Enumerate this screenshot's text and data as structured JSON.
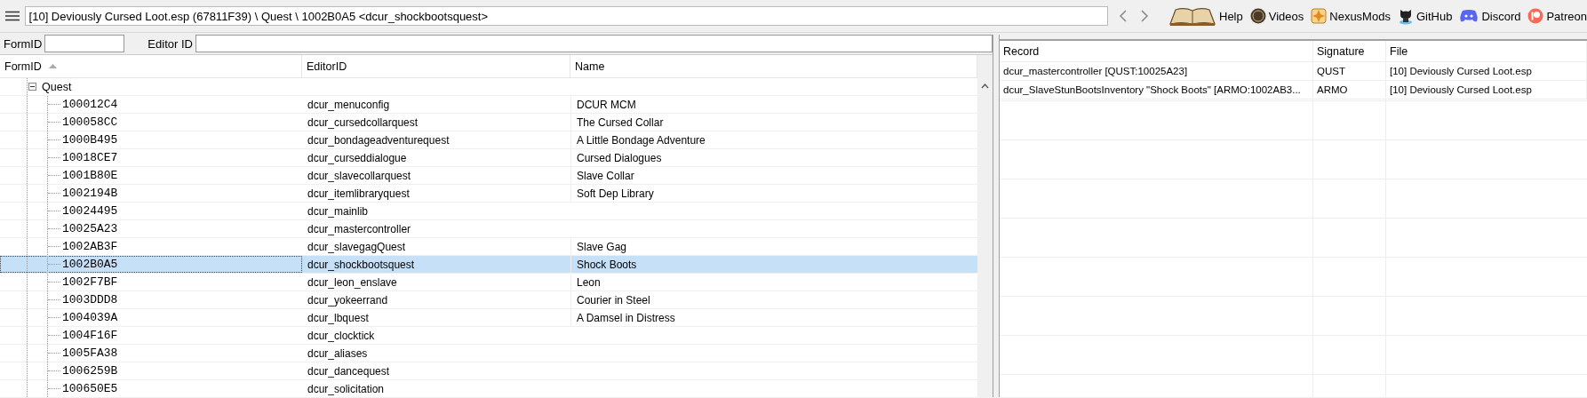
{
  "address": "[10] Deviously Cursed Loot.esp (67811F39) \\ Quest \\ 1002B0A5 <dcur_shockbootsquest>",
  "links": [
    {
      "kind": "book",
      "label": "Help"
    },
    {
      "kind": "coin",
      "label": "Videos"
    },
    {
      "kind": "star",
      "label": "NexusMods"
    },
    {
      "kind": "cat",
      "label": "GitHub"
    },
    {
      "kind": "controller",
      "label": "Discord"
    },
    {
      "kind": "ring",
      "label": "Patreon"
    }
  ],
  "filters": [
    {
      "label": "FormID"
    },
    {
      "label": "Editor ID"
    }
  ],
  "tree": {
    "columns": [
      {
        "label": "FormID",
        "sorted": true
      },
      {
        "label": "EditorID",
        "sorted": false
      },
      {
        "label": "Name",
        "sorted": false
      }
    ],
    "nodes": [
      {
        "label": "Quest",
        "expanded": true,
        "children": [
          {
            "form_id": "100012C4",
            "editor_id": "dcur_menuconfig",
            "name": "DCUR MCM",
            "selected": false
          },
          {
            "form_id": "100058CC",
            "editor_id": "dcur_cursedcollarquest",
            "name": "The Cursed Collar",
            "selected": false
          },
          {
            "form_id": "1000B495",
            "editor_id": "dcur_bondageadventurequest",
            "name": "A Little Bondage Adventure",
            "selected": false
          },
          {
            "form_id": "10018CE7",
            "editor_id": "dcur_curseddialogue",
            "name": "Cursed Dialogues",
            "selected": false
          },
          {
            "form_id": "1001B80E",
            "editor_id": "dcur_slavecollarquest",
            "name": "Slave Collar",
            "selected": false
          },
          {
            "form_id": "1002194B",
            "editor_id": "dcur_itemlibraryquest",
            "name": "Soft Dep Library",
            "selected": false
          },
          {
            "form_id": "10024495",
            "editor_id": "dcur_mainlib",
            "selected": false
          },
          {
            "form_id": "10025A23",
            "editor_id": "dcur_mastercontroller",
            "selected": false
          },
          {
            "form_id": "1002AB3F",
            "editor_id": "dcur_slavegagQuest",
            "name": "Slave Gag",
            "selected": false
          },
          {
            "form_id": "1002B0A5",
            "editor_id": "dcur_shockbootsquest",
            "name": "Shock Boots",
            "selected": true
          },
          {
            "form_id": "1002F7BF",
            "editor_id": "dcur_leon_enslave",
            "name": "Leon",
            "selected": false
          },
          {
            "form_id": "1003DDD8",
            "editor_id": "dcur_yokeerrand",
            "name": "Courier in Steel",
            "selected": false
          },
          {
            "form_id": "1004039A",
            "editor_id": "dcur_lbquest",
            "name": "A Damsel in Distress",
            "selected": false
          },
          {
            "form_id": "1004F16F",
            "editor_id": "dcur_clocktick",
            "selected": false
          },
          {
            "form_id": "1005FA38",
            "editor_id": "dcur_aliases",
            "selected": false
          },
          {
            "form_id": "1006259B",
            "editor_id": "dcur_dancequest",
            "selected": false
          },
          {
            "form_id": "100650E5",
            "editor_id": "dcur_solicitation",
            "selected": false
          }
        ]
      }
    ]
  },
  "references": {
    "columns": [
      "Record",
      "Signature",
      "File"
    ],
    "rows": [
      {
        "record": "dcur_mastercontroller [QUST:10025A23]",
        "signature": "QUST",
        "file": "[10] Deviously Cursed Loot.esp"
      },
      {
        "record": "dcur_SlaveStunBootsInventory \"Shock Boots\" [ARMO:1002AB3...",
        "signature": "ARMO",
        "file": "[10] Deviously Cursed Loot.esp"
      }
    ]
  }
}
